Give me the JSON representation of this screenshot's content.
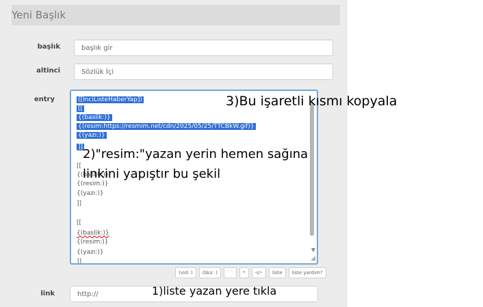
{
  "header": {
    "title": "Yeni Başlık"
  },
  "form": {
    "title_label": "başlık",
    "title_placeholder": "başlık gir",
    "category_label": "altinci",
    "category_value": "Sözlük İçi",
    "entry_label": "entry",
    "link_label": "link",
    "link_placeholder": "http://"
  },
  "editor": {
    "lines_selected": [
      "([InciListeHaberYap])",
      "[[",
      "{(baslik:)}",
      "{(resim:https://resmim.net/cdn/2025/05/25/TTCBkW.gif)}",
      "{(yazı:)}",
      "]]"
    ],
    "lines_rest": [
      "[[",
      "{(baslik:)}",
      "{(resim:)}",
      "{(yazı:)}",
      "]]",
      "",
      "[[",
      "{(baslik:)}",
      "{(resim:)}",
      "{(yazı:)}",
      "]]"
    ]
  },
  "toolbar": {
    "buttons": [
      "(vid: )",
      "(bkz: )",
      "` `",
      "*",
      "-s!-",
      "liste",
      "liste yardım?"
    ]
  },
  "annotations": {
    "step1": "1)liste yazan yere tıkla",
    "step2_line1": "2)\"resim:\"yazan yerin hemen sağına",
    "step2_line2": "linkini yapıştır bu şekil",
    "step3": "3)Bu işaretli kısmı kopyala"
  }
}
